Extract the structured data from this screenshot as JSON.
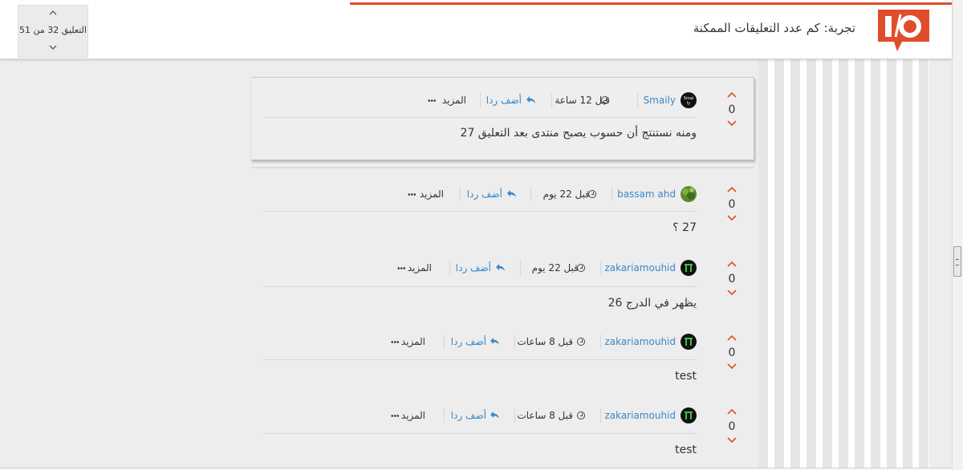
{
  "header": {
    "title": "تجربة: كم عدد التعليقات الممكنة",
    "accent_color": "#e04d2b",
    "logo_icon": "io-logo-icon"
  },
  "counter": {
    "label": "التعليق 32 من 51",
    "up_icon": "chevron-up-icon",
    "down_icon": "chevron-down-icon"
  },
  "actions": {
    "reply_label": "أضف ردا",
    "more_label": "المزيد"
  },
  "comments": [
    {
      "author": "Smaily",
      "time": "قبل 12 ساعة",
      "votes": "0",
      "text": "ومنه نستنتج أن حسوب يصبح منتدى بعد التعليق 27",
      "avatar_color": "#111111",
      "highlighted": true
    },
    {
      "author": "bassam ahd",
      "time": "قبل 22 يوم",
      "votes": "0",
      "text": "27 ؟",
      "avatar_color": "#5c8a2e"
    },
    {
      "author": "zakariamouhid",
      "time": "قبل 22 يوم",
      "votes": "0",
      "text": "يظهر في الدرج 26",
      "avatar_color": "#111111"
    },
    {
      "author": "zakariamouhid",
      "time": "قبل 8 ساعات",
      "votes": "0",
      "text": "test",
      "avatar_color": "#111111"
    },
    {
      "author": "zakariamouhid",
      "time": "قبل 8 ساعات",
      "votes": "0",
      "text": "test",
      "avatar_color": "#111111"
    }
  ]
}
